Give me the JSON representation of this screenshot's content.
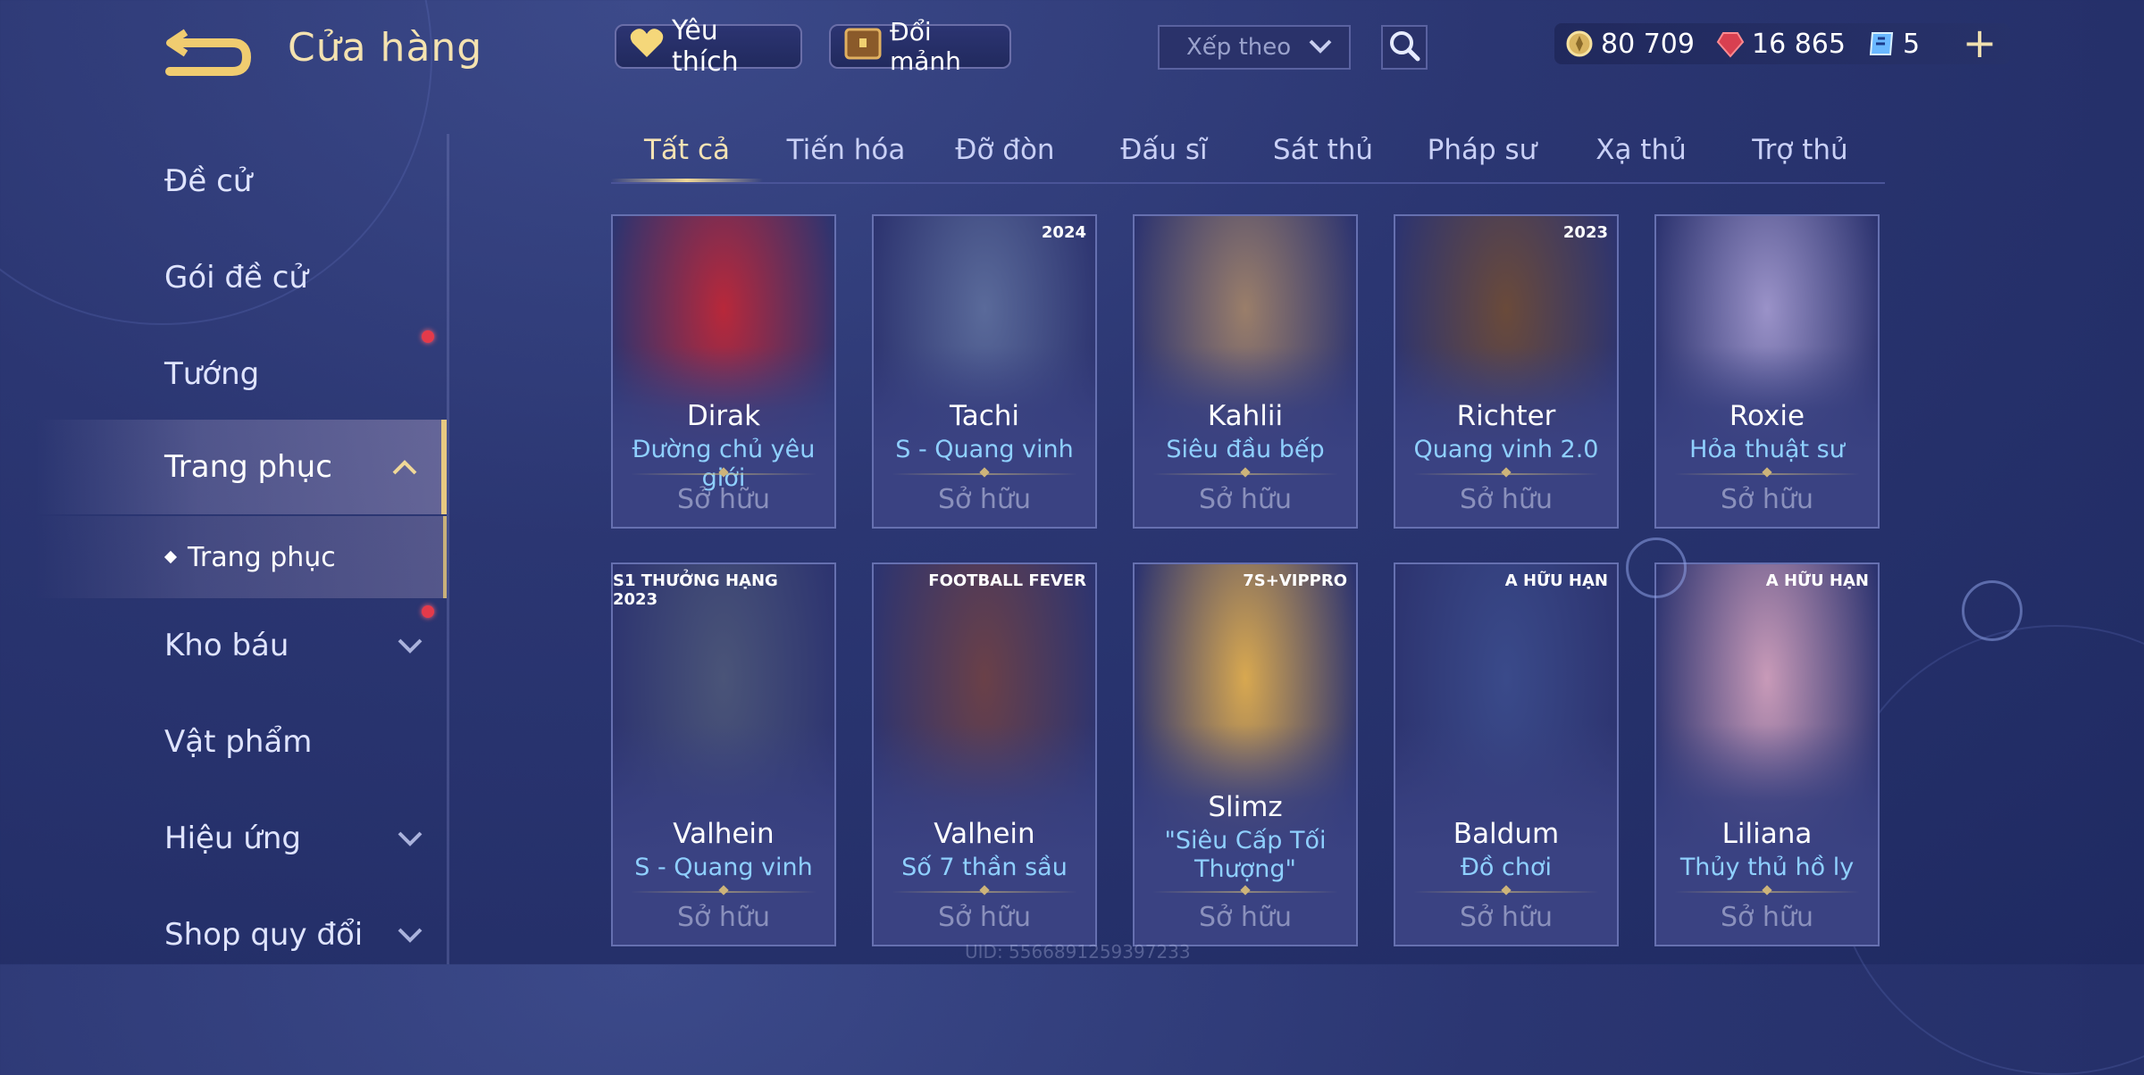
{
  "header": {
    "title": "Cửa hàng",
    "favorite_label": "Yêu thích",
    "fragment_label": "Đổi mảnh",
    "sort_placeholder": "Xếp theo",
    "currencies": [
      {
        "icon": "gold-coin-icon",
        "value": "80 709"
      },
      {
        "icon": "ruby-gem-icon",
        "value": "16 865"
      },
      {
        "icon": "voucher-icon",
        "value": "5"
      }
    ]
  },
  "sidebar": {
    "items": [
      {
        "label": "Đề cử"
      },
      {
        "label": "Gói đề cử"
      },
      {
        "label": "Tướng"
      },
      {
        "label": "Trang phục"
      },
      {
        "label": "Kho báu"
      },
      {
        "label": "Vật phẩm"
      },
      {
        "label": "Hiệu ứng"
      },
      {
        "label": "Shop quy đổi"
      }
    ],
    "sub_item": "Trang phục"
  },
  "tabs": [
    "Tất cả",
    "Tiến hóa",
    "Đỡ đòn",
    "Đấu sĩ",
    "Sát thủ",
    "Pháp sư",
    "Xạ thủ",
    "Trợ thủ"
  ],
  "cards": [
    {
      "hero": "Dirak",
      "skin": "Đường chủ yêu giới",
      "status": "Sở hữu",
      "badge": "",
      "art": "#b8283a"
    },
    {
      "hero": "Tachi",
      "skin": "S - Quang vinh",
      "status": "Sở hữu",
      "badge": "2024",
      "art": "#5a6a9a"
    },
    {
      "hero": "Kahlii",
      "skin": "Siêu đầu bếp",
      "status": "Sở hữu",
      "badge": "",
      "art": "#9a7e6a"
    },
    {
      "hero": "Richter",
      "skin": "Quang vinh 2.0",
      "status": "Sở hữu",
      "badge": "2023",
      "art": "#6a4a3a"
    },
    {
      "hero": "Roxie",
      "skin": "Hỏa thuật sư",
      "status": "Sở hữu",
      "badge": "",
      "art": "#9a92c8"
    },
    {
      "hero": "Valhein",
      "skin": "S - Quang vinh",
      "status": "Sở hữu",
      "badge": "S1 THƯỞNG HẠNG 2023",
      "art": "#4a5478"
    },
    {
      "hero": "Valhein",
      "skin": "Số 7 thần sầu",
      "status": "Sở hữu",
      "badge": "FOOTBALL FEVER",
      "art": "#6a4048"
    },
    {
      "hero": "Slimz",
      "skin": "\"Siêu Cấp Tối Thượng\"",
      "status": "Sở hữu",
      "badge": "7S+VIPPRO",
      "art": "#d8a850"
    },
    {
      "hero": "Baldum",
      "skin": "Đồ chơi",
      "status": "Sở hữu",
      "badge": "A HỮU HẠN",
      "art": "#3a4a8a"
    },
    {
      "hero": "Liliana",
      "skin": "Thủy thủ hồ ly",
      "status": "Sở hữu",
      "badge": "A HỮU HẠN",
      "art": "#c89ab8"
    }
  ],
  "footer": {
    "uid": "UID: 5566891259397233"
  }
}
